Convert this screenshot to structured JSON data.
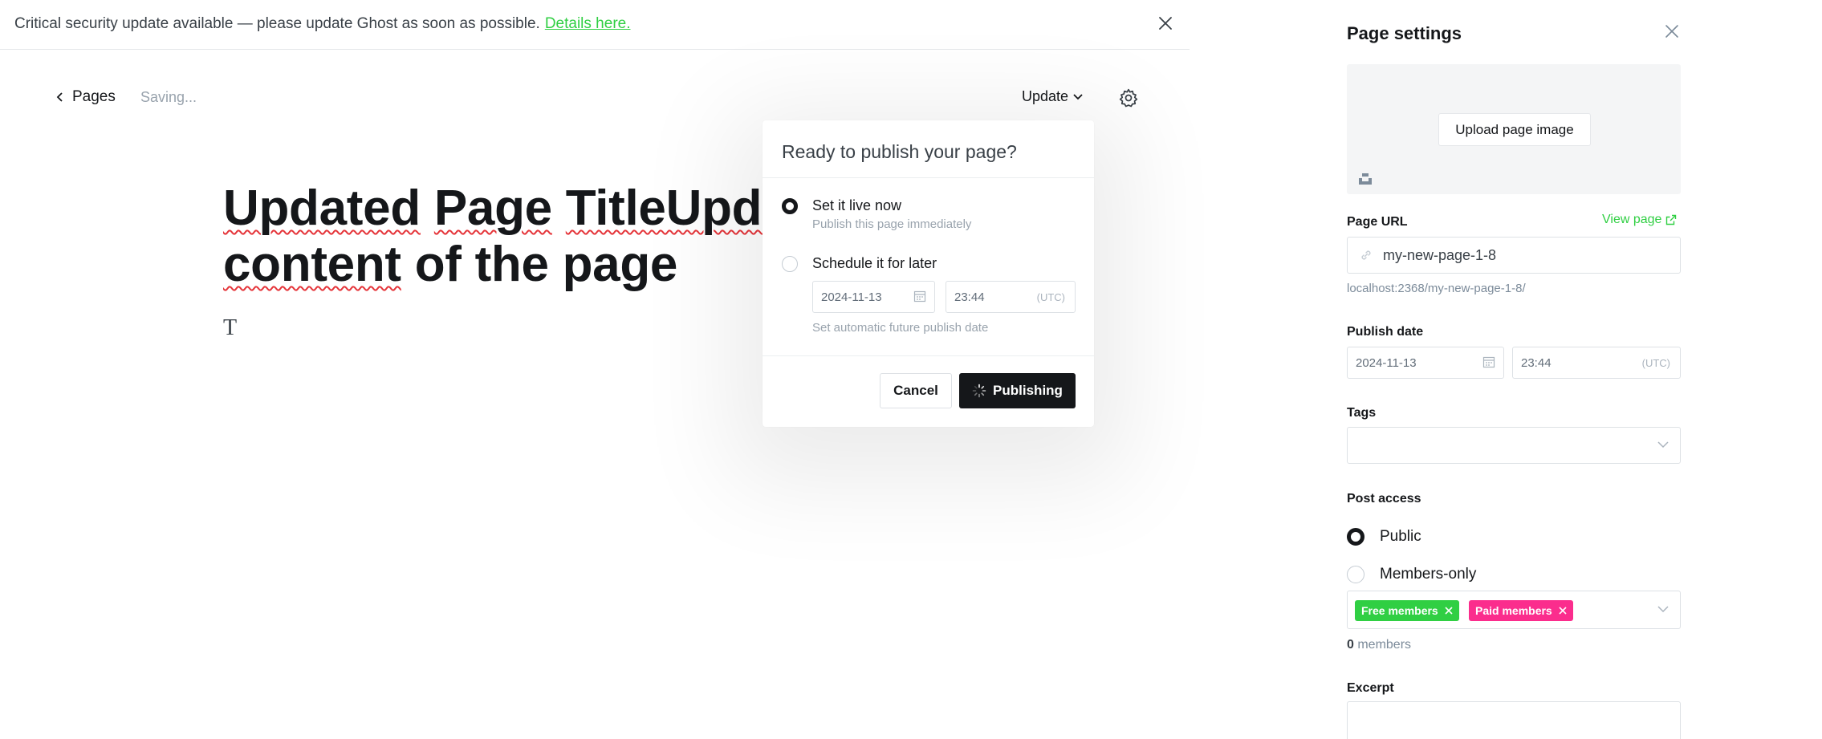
{
  "banner": {
    "message": "Critical security update available — please update Ghost as soon as possible.",
    "link": "Details here."
  },
  "editor": {
    "back_label": "Pages",
    "status": "Saving...",
    "update_label": "Update",
    "title_line1_a": "Updated",
    "title_line1_b": "Page",
    "title_line1_c": "TitleUpdat",
    "title_line2_a": "content",
    "title_line2_b": "of the page",
    "body_char": "T"
  },
  "publish_modal": {
    "heading": "Ready to publish your page?",
    "option_now_label": "Set it live now",
    "option_now_sub": "Publish this page immediately",
    "option_later_label": "Schedule it for later",
    "date": "2024-11-13",
    "time": "23:44",
    "timezone": "(UTC)",
    "later_sub": "Set automatic future publish date",
    "cancel_label": "Cancel",
    "publish_label": "Publishing"
  },
  "settings": {
    "title": "Page settings",
    "upload_label": "Upload page image",
    "url_label": "Page URL",
    "view_page": "View page",
    "url_value": "my-new-page-1-8",
    "url_hint": "localhost:2368/my-new-page-1-8/",
    "publish_date_label": "Publish date",
    "date": "2024-11-13",
    "time": "23:44",
    "timezone": "(UTC)",
    "tags_label": "Tags",
    "access_label": "Post access",
    "access_public": "Public",
    "access_members": "Members-only",
    "chip_free": "Free members",
    "chip_paid": "Paid members",
    "members_count": "0",
    "members_suffix": " members",
    "excerpt_label": "Excerpt"
  },
  "colors": {
    "accent_green": "#30cf43",
    "paid_pink": "#fb2d8d",
    "dark": "#15171a"
  }
}
